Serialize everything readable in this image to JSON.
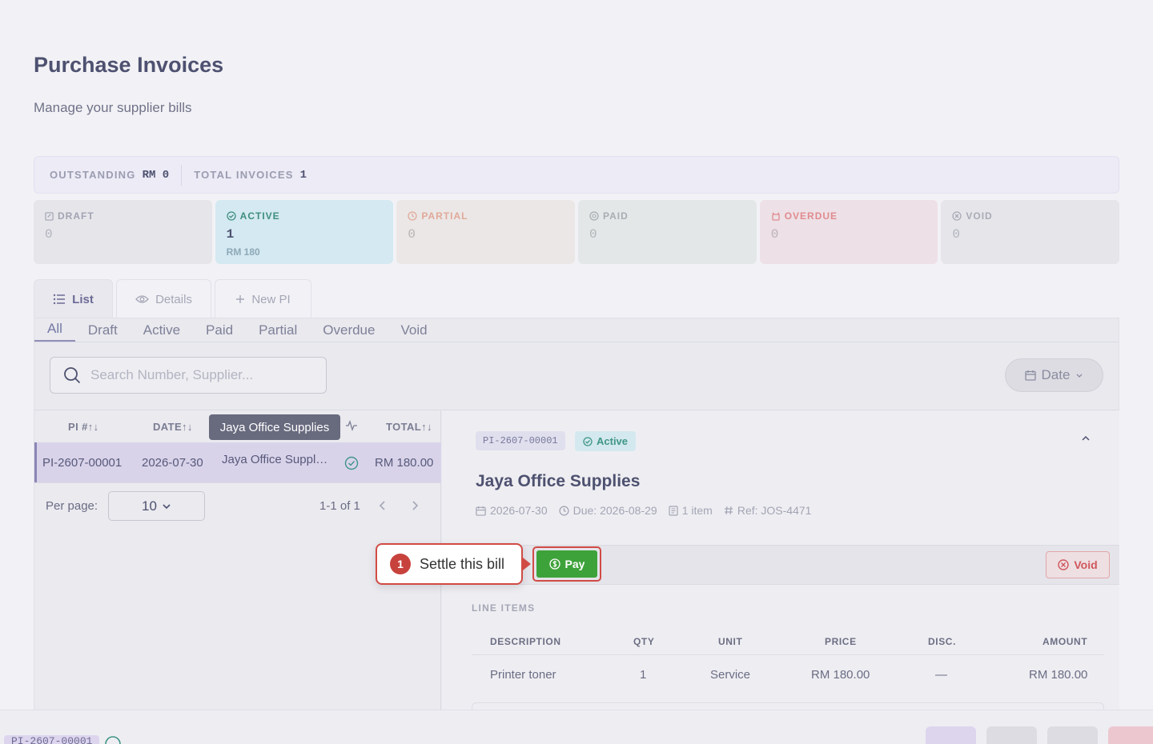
{
  "page": {
    "title": "Purchase Invoices",
    "subtitle": "Manage your supplier bills"
  },
  "summary": {
    "outstanding_label": "OUTSTANDING",
    "outstanding_value": "RM 0",
    "total_label": "TOTAL INVOICES",
    "total_value": "1"
  },
  "status_cards": [
    {
      "label": "DRAFT",
      "count": "0",
      "amount": "",
      "icon": "draft-icon"
    },
    {
      "label": "ACTIVE",
      "count": "1",
      "amount": "RM 180",
      "icon": "check-circle-icon"
    },
    {
      "label": "PARTIAL",
      "count": "0",
      "amount": "",
      "icon": "clock-icon"
    },
    {
      "label": "PAID",
      "count": "0",
      "amount": "",
      "icon": "coin-icon"
    },
    {
      "label": "OVERDUE",
      "count": "0",
      "amount": "",
      "icon": "alarm-icon"
    },
    {
      "label": "VOID",
      "count": "0",
      "amount": "",
      "icon": "x-circle-icon"
    }
  ],
  "view_tabs": [
    {
      "label": "List",
      "active": true
    },
    {
      "label": "Details",
      "active": false
    },
    {
      "label": "New PI",
      "active": false
    }
  ],
  "filter_tabs": [
    "All",
    "Draft",
    "Active",
    "Paid",
    "Partial",
    "Overdue",
    "Void"
  ],
  "search": {
    "placeholder": "Search Number, Supplier...",
    "value": ""
  },
  "date_filter": {
    "label": "Date"
  },
  "table": {
    "columns": {
      "pi": "PI #",
      "date": "DATE",
      "total": "TOTAL"
    },
    "tooltip": "Jaya Office Supplies",
    "rows": [
      {
        "pi": "PI-2607-00001",
        "date": "2026-07-30",
        "supplier": "Jaya Office Suppl…",
        "total": "RM 180.00"
      }
    ]
  },
  "pager": {
    "per_page_label": "Per page:",
    "per_page_value": "10",
    "range": "1-1 of 1"
  },
  "detail": {
    "number": "PI-2607-00001",
    "status": "Active",
    "supplier": "Jaya Office Supplies",
    "date": "2026-07-30",
    "due": "Due: 2026-08-29",
    "items": "1 item",
    "ref": "Ref: JOS-4471",
    "pay_label": "Pay",
    "void_label": "Void",
    "line_items_label": "LINE ITEMS",
    "line_columns": {
      "description": "DESCRIPTION",
      "qty": "QTY",
      "unit": "UNIT",
      "price": "PRICE",
      "disc": "DISC.",
      "amount": "AMOUNT"
    },
    "line_items": [
      {
        "description": "Printer toner",
        "qty": "1",
        "unit": "Service",
        "price": "RM 180.00",
        "disc": "—",
        "amount": "RM 180.00"
      }
    ]
  },
  "callout": {
    "number": "1",
    "text": "Settle this bill"
  },
  "bottom_bar": {
    "number": "PI-2607-00001"
  },
  "colors": {
    "accent": "#6d6a96",
    "pay": "#3ea23a",
    "void": "#d0575c",
    "callout": "#d14b45"
  }
}
